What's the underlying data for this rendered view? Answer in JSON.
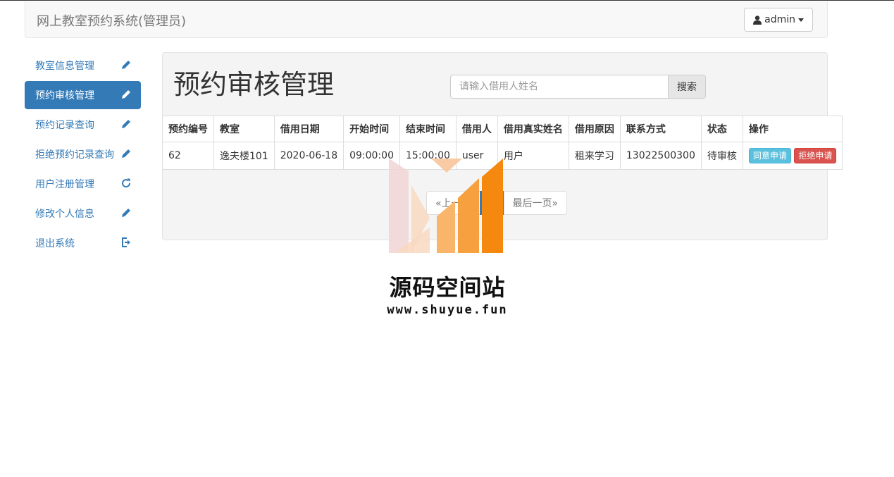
{
  "app": {
    "title": "网上教室预约系统(管理员)"
  },
  "user_menu": {
    "label": "admin",
    "icon": "user-icon",
    "caret": "caret-down-icon"
  },
  "sidebar": {
    "items": [
      {
        "label": "教室信息管理",
        "icon": "pencil-icon"
      },
      {
        "label": "预约审核管理",
        "icon": "pencil-icon",
        "active": true
      },
      {
        "label": "预约记录查询",
        "icon": "pencil-icon"
      },
      {
        "label": "拒绝预约记录查询",
        "icon": "pencil-icon"
      },
      {
        "label": "用户注册管理",
        "icon": "refresh-icon"
      },
      {
        "label": "修改个人信息",
        "icon": "pencil-icon"
      },
      {
        "label": "退出系统",
        "icon": "logout-icon"
      }
    ]
  },
  "main": {
    "title": "预约审核管理",
    "search": {
      "placeholder": "请输入借用人姓名",
      "value": "",
      "button": "搜索"
    },
    "table": {
      "headers": [
        "预约编号",
        "教室",
        "借用日期",
        "开始时间",
        "结束时间",
        "借用人",
        "借用真实姓名",
        "借用原因",
        "联系方式",
        "状态",
        "操作"
      ],
      "rows": [
        {
          "id": "62",
          "room": "逸夫楼101",
          "date": "2020-06-18",
          "start": "09:00:00",
          "end": "15:00:00",
          "borrower": "user",
          "real_name": "用户",
          "reason": "租来学习",
          "phone": "13022500300",
          "status": "待审核",
          "actions": {
            "approve": "同意申请",
            "reject": "拒绝申请"
          }
        }
      ]
    },
    "pagination": {
      "prev": "«上一页",
      "current": "1",
      "last": "最后一页»"
    }
  },
  "watermark": {
    "title": "源码空间站",
    "url": "www.shuyue.fun"
  },
  "colors": {
    "primary": "#337ab7",
    "info": "#5bc0de",
    "danger": "#d9534f",
    "watermark_orange": "#f5890f"
  }
}
